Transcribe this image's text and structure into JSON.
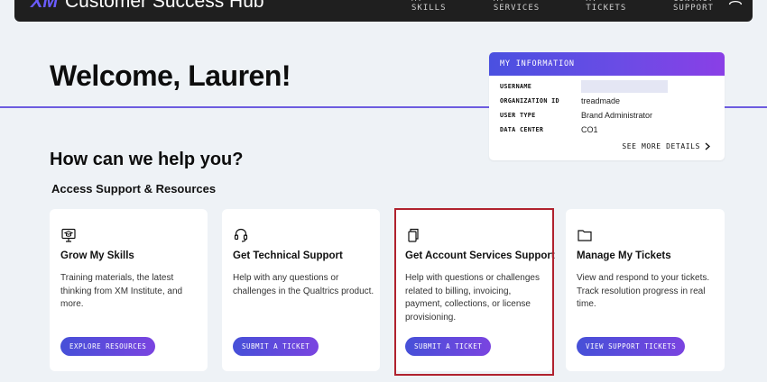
{
  "header": {
    "logo_mark": "XM",
    "app_title": "Customer Success Hub",
    "nav": [
      "MY SKILLS",
      "MY SERVICES",
      "MY TICKETS",
      "CONTACT SUPPORT"
    ],
    "user_icon": "user-icon"
  },
  "welcome": "Welcome, Lauren!",
  "info": {
    "title": "MY INFORMATION",
    "rows": [
      {
        "key": "USERNAME",
        "value": ""
      },
      {
        "key": "ORGANIZATION ID",
        "value": "treadmade"
      },
      {
        "key": "USER TYPE",
        "value": "Brand Administrator"
      },
      {
        "key": "DATA CENTER",
        "value": "CO1"
      }
    ],
    "see_more": "SEE MORE DETAILS"
  },
  "help_title": "How can we help you?",
  "section_title": "Access Support & Resources",
  "cards": [
    {
      "icon": "screen-learning-icon",
      "title": "Grow My Skills",
      "desc": "Training materials, the latest thinking from XM Institute, and more.",
      "button": "EXPLORE RESOURCES"
    },
    {
      "icon": "headset-icon",
      "title": "Get Technical Support",
      "desc": "Help with any questions or challenges in the Qualtrics product.",
      "button": "SUBMIT A TICKET"
    },
    {
      "icon": "copy-documents-icon",
      "title": "Get Account Services Support",
      "desc": "Help with questions or challenges related to billing, invoicing, payment, collections, or license provisioning.",
      "button": "SUBMIT A TICKET"
    },
    {
      "icon": "folder-icon",
      "title": "Manage My Tickets",
      "desc": "View and respond to your tickets. Track resolution progress in real time.",
      "button": "VIEW SUPPORT TICKETS"
    }
  ],
  "colors": {
    "accent": "#6d5ce0",
    "button_gradient_start": "#4650d8",
    "button_gradient_end": "#7a44e0",
    "highlight": "#b0222e",
    "topbar": "#1f1f1f",
    "background": "#eef2f6"
  }
}
